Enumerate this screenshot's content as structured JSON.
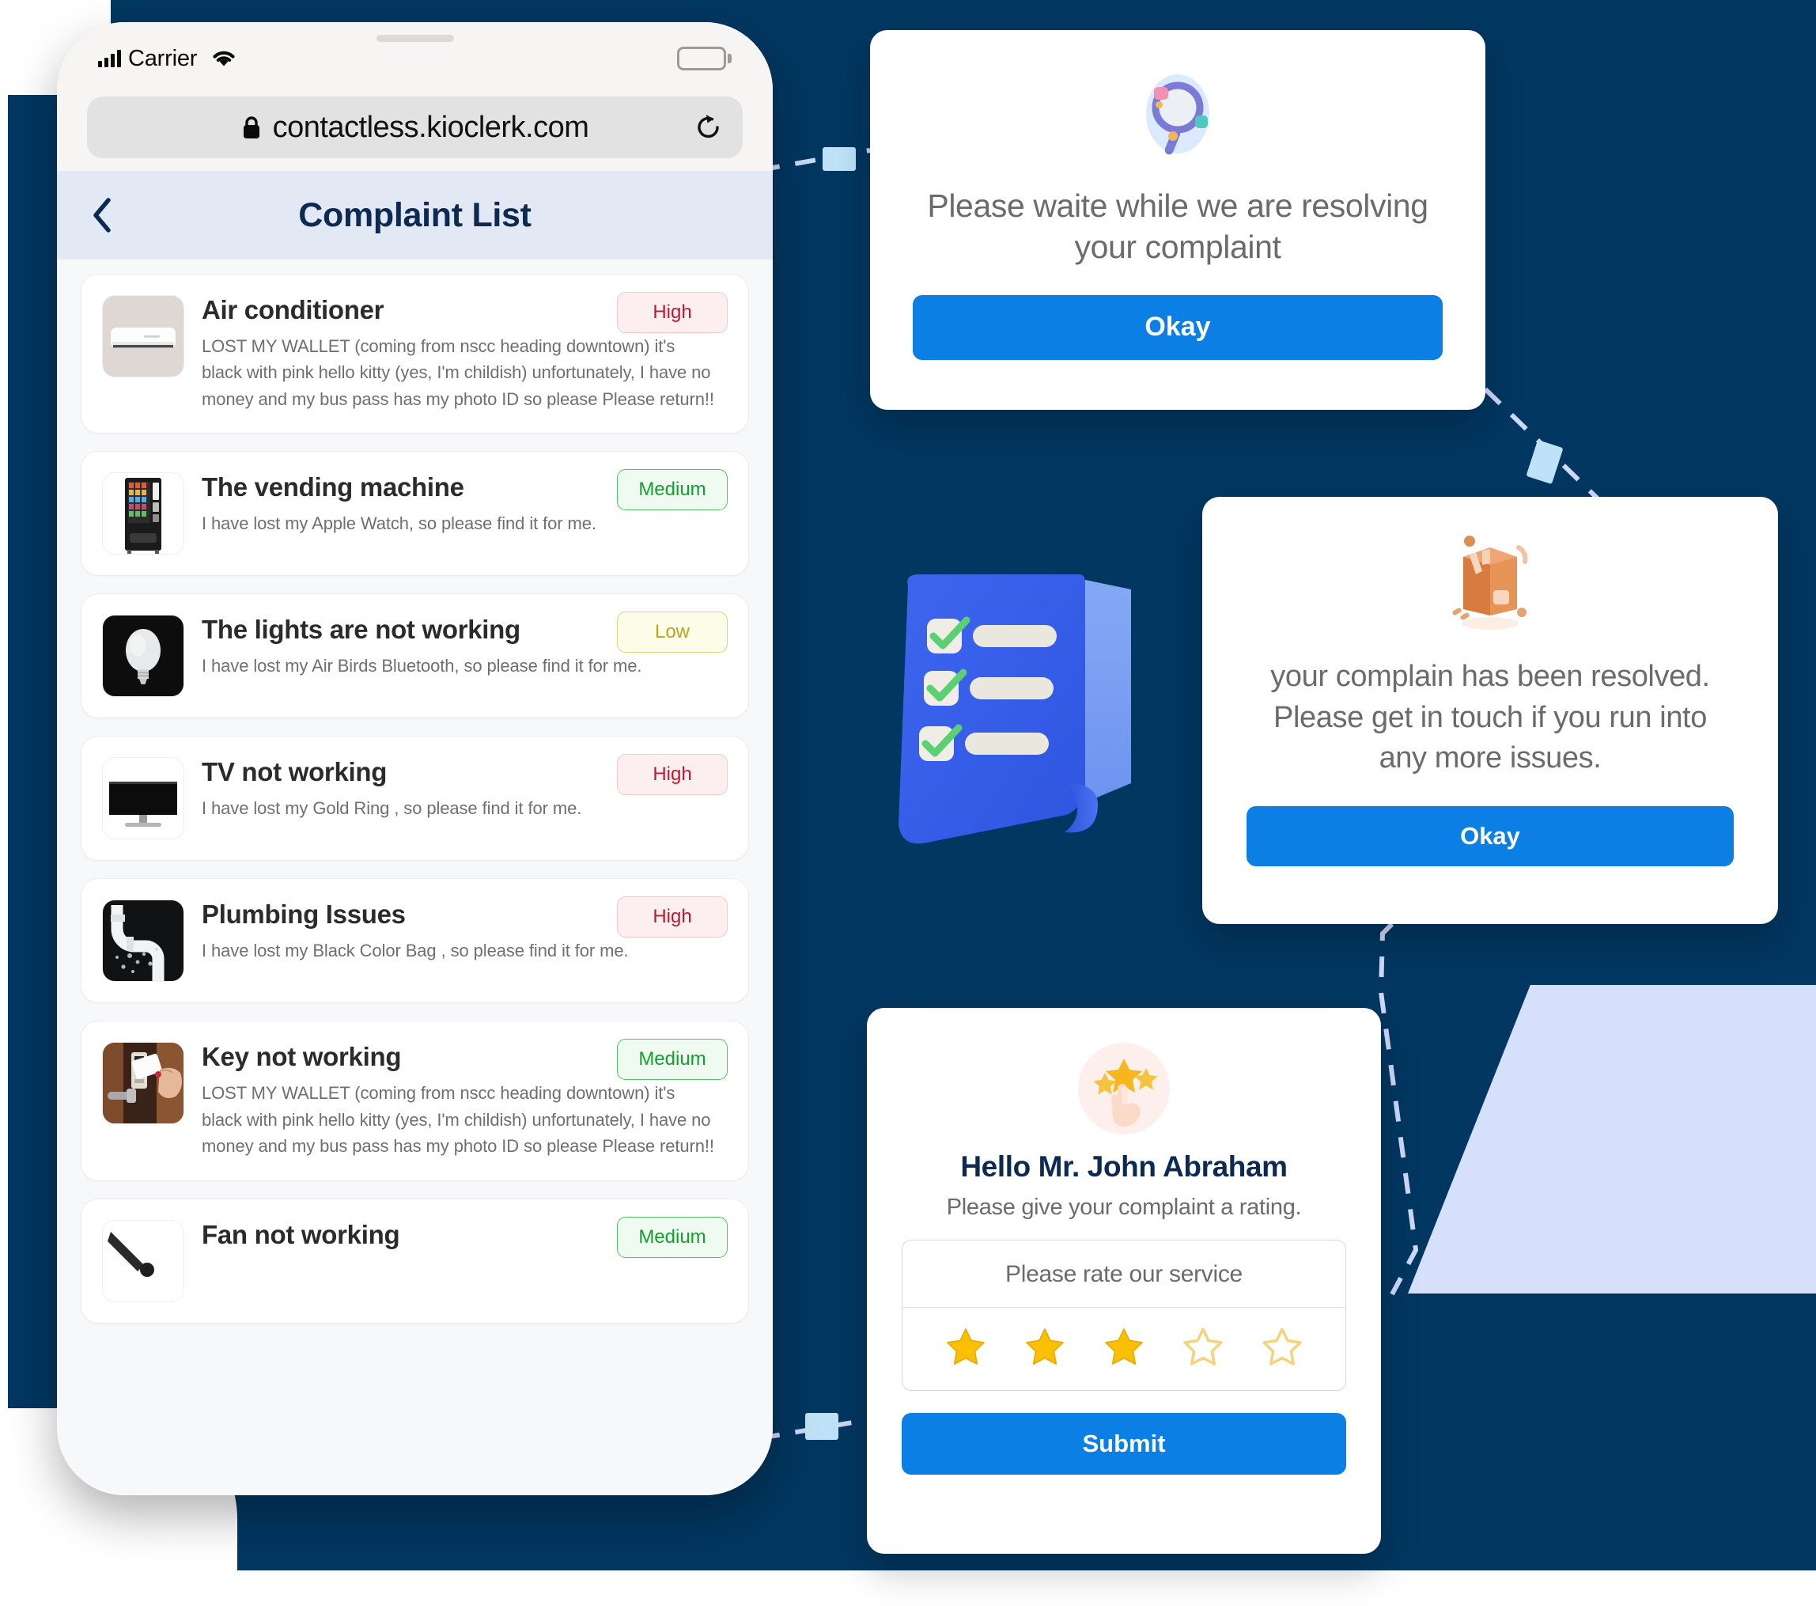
{
  "background": {
    "navy": "#023761",
    "lavender_shape": "#d6e0fb",
    "connector_color": "#cdd9f7"
  },
  "phone": {
    "status_bar": {
      "carrier": "Carrier",
      "signal_icon": "signal-bars-icon",
      "wifi_icon": "wifi-icon",
      "battery_icon": "battery-full-icon"
    },
    "browser": {
      "lock_icon": "lock-icon",
      "url": "contactless.kioclerk.com",
      "reload_icon": "reload-icon"
    },
    "app_header": {
      "back_icon": "chevron-left-icon",
      "title": "Complaint List"
    },
    "complaints": [
      {
        "thumb": "air-conditioner-photo",
        "title": "Air conditioner",
        "description": "LOST MY WALLET (coming from nscc heading downtown) it's black with pink hello kitty (yes, I'm childish) unfortunately, I have no money and my bus pass has my photo ID so please Please return!!",
        "priority": "High",
        "priority_class": "b-high"
      },
      {
        "thumb": "vending-machine-photo",
        "title": "The vending machine",
        "description": "I have lost my Apple Watch, so please find it for me.",
        "priority": "Medium",
        "priority_class": "b-medium"
      },
      {
        "thumb": "light-bulb-photo",
        "title": "The lights are not working",
        "description": "I have lost my Air Birds Bluetooth, so  please find it for me.",
        "priority": "Low",
        "priority_class": "b-low"
      },
      {
        "thumb": "television-photo",
        "title": "TV not working",
        "description": "I have lost my Gold Ring , so please find it for me.",
        "priority": "High",
        "priority_class": "b-high"
      },
      {
        "thumb": "leaking-pipe-photo",
        "title": "Plumbing Issues",
        "description": "I have lost my Black Color Bag  , so please find it for me.",
        "priority": "High",
        "priority_class": "b-high"
      },
      {
        "thumb": "keycard-door-photo",
        "title": "Key not working",
        "description": "LOST MY WALLET (coming from nscc heading downtown) it's black with pink hello kitty (yes, I'm childish) unfortunately, I have no money and my bus pass has my photo ID so please Please return!!",
        "priority": "Medium",
        "priority_class": "b-medium"
      },
      {
        "thumb": "ceiling-fan-photo",
        "title": "Fan not working",
        "description": "",
        "priority": "Medium",
        "priority_class": "b-medium"
      }
    ]
  },
  "modal_wait": {
    "illustration_icon": "magnifying-glass-3d-icon",
    "message": "Please waite while we are resolving your complaint",
    "button_label": "Okay"
  },
  "modal_resolved": {
    "illustration_icon": "package-box-3d-icon",
    "message": "your complain has been resolved. Please get in touch if you run into any more issues.",
    "button_label": "Okay"
  },
  "modal_rating": {
    "illustration_icon": "hand-tapping-stars-3d-icon",
    "greeting": "Hello Mr. John Abraham",
    "subtitle": "Please give your complaint a rating.",
    "field_label": "Please rate our service",
    "stars_filled": 3,
    "stars_total": 5,
    "button_label": "Submit"
  },
  "center_illustration": {
    "icon": "checklist-clipboard-3d-icon",
    "checked_items": 3
  }
}
